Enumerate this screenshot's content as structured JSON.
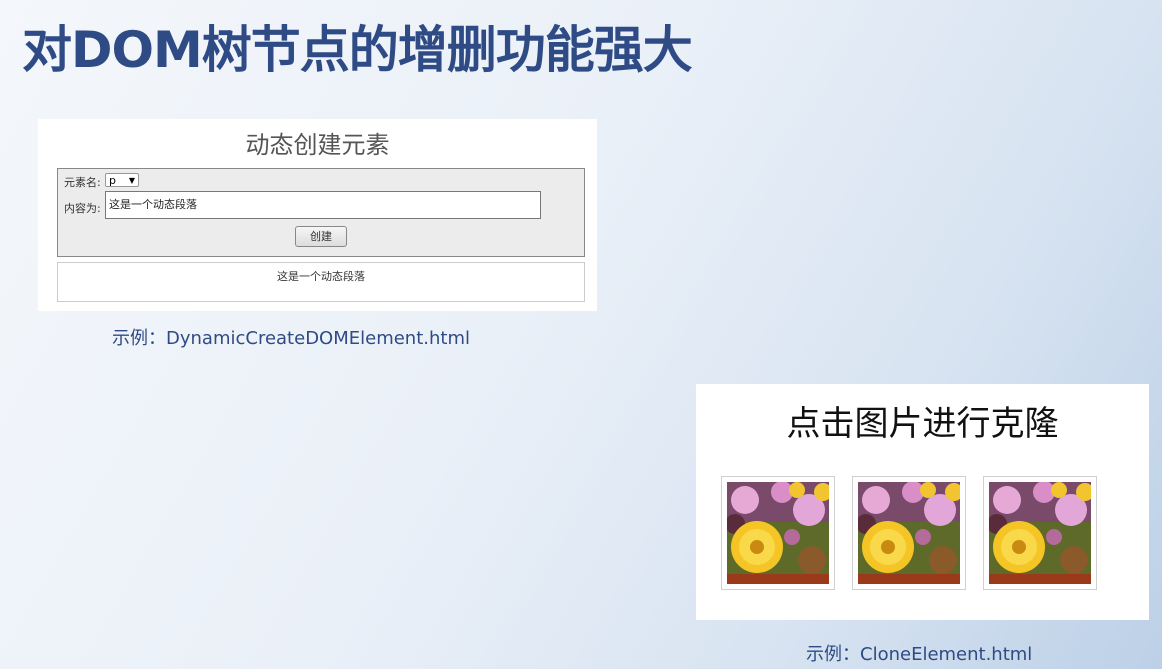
{
  "slide": {
    "title": "对DOM树节点的增删功能强大"
  },
  "demo1": {
    "heading": "动态创建元素",
    "tag_label": "元素名:",
    "tag_value": "p",
    "content_label": "内容为:",
    "content_value": "这是一个动态段落",
    "button_label": "创建",
    "output_text": "这是一个动态段落",
    "caption_prefix": "示例：",
    "caption_file": "DynamicCreateDOMElement.html"
  },
  "demo2": {
    "heading": "点击图片进行克隆",
    "images": [
      {
        "icon": "flower-photo"
      },
      {
        "icon": "flower-photo"
      },
      {
        "icon": "flower-photo"
      }
    ],
    "caption_prefix": "示例：",
    "caption_file": "CloneElement.html"
  },
  "colors": {
    "title": "#2f4b85",
    "caption": "#2f4b85"
  }
}
